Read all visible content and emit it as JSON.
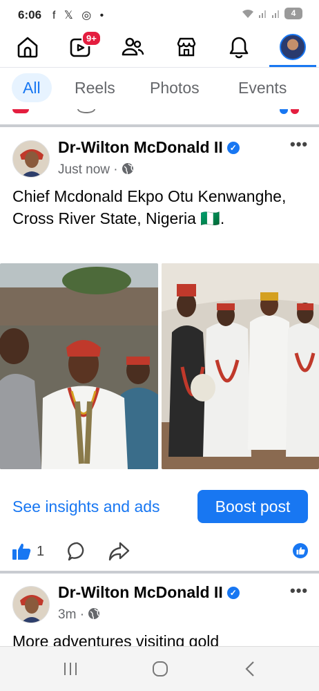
{
  "status": {
    "time": "6:06",
    "app_icons": "f 𝕏 ◎ •",
    "battery": "4"
  },
  "nav": {
    "notifications_badge": "9+"
  },
  "tabs": [
    {
      "label": "All",
      "active": true
    },
    {
      "label": "Reels",
      "active": false
    },
    {
      "label": "Photos",
      "active": false
    },
    {
      "label": "Events",
      "active": false
    }
  ],
  "post1": {
    "author": "Dr-Wilton McDonald II",
    "time": "Just now",
    "text": "Chief Mcdonald Ekpo Otu Kenwanghe, Cross River State, Nigeria 🇳🇬.",
    "insights_label": "See insights and ads",
    "boost_label": "Boost post",
    "like_count": "1"
  },
  "post2": {
    "author": "Dr-Wilton McDonald II",
    "time": "3m",
    "text": "More adventures visiting gold"
  },
  "colors": {
    "accent": "#1877f2",
    "badge": "#e41e3f",
    "muted": "#65676b"
  },
  "icons": [
    "home-icon",
    "video-icon",
    "friends-icon",
    "marketplace-icon",
    "bell-icon",
    "profile-avatar",
    "globe-icon",
    "verified-icon",
    "like-icon",
    "comment-icon",
    "share-icon",
    "more-icon"
  ]
}
